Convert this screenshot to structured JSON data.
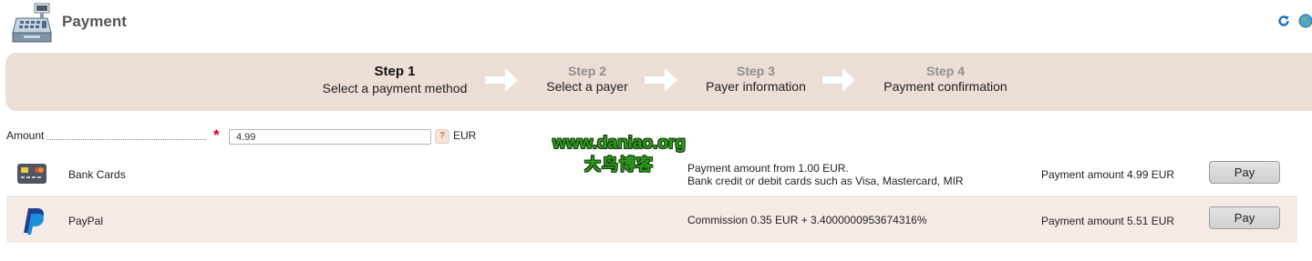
{
  "header": {
    "title": "Payment"
  },
  "steps": [
    {
      "number": "Step 1",
      "label": "Select a payment method",
      "active": true
    },
    {
      "number": "Step 2",
      "label": "Select a payer",
      "active": false
    },
    {
      "number": "Step 3",
      "label": "Payer information",
      "active": false
    },
    {
      "number": "Step 4",
      "label": "Payment confirmation",
      "active": false
    }
  ],
  "amount": {
    "label": "Amount",
    "required_mark": "*",
    "value": "4.99",
    "help": "?",
    "currency": "EUR"
  },
  "watermark": {
    "line1": "www.daniao.org",
    "line2": "大鸟博客"
  },
  "methods": [
    {
      "name": "Bank Cards",
      "icon": "credit-card-icon",
      "info_line1": "Payment amount from 1.00 EUR.",
      "info_line2": "Bank credit or debit cards such as Visa, Mastercard, MIR",
      "amount": "Payment amount 4.99 EUR",
      "button": "Pay"
    },
    {
      "name": "PayPal",
      "icon": "paypal-icon",
      "info_line1": "Commission 0.35 EUR + 3.4000000953674316%",
      "amount": "Payment amount 5.51 EUR",
      "button": "Pay"
    }
  ],
  "colors": {
    "steps_bar_bg": "#ecddd5",
    "paypal_row_bg": "#f5ebe6",
    "required": "#d0021b",
    "watermark_green": "#2f9a1c"
  }
}
